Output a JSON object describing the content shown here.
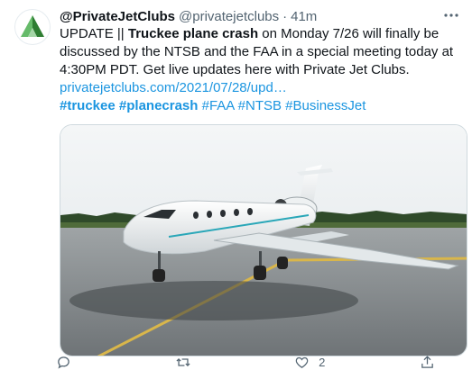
{
  "tweet": {
    "display_name": "@PrivateJetClubs",
    "handle": "@privatejetclubs",
    "separator": "·",
    "time": "41m",
    "text": {
      "prefix": "UPDATE || ",
      "bold": "Truckee plane crash",
      "rest": " on Monday 7/26 will finally be discussed by the NTSB and the FAA in a special meeting today at 4:30PM PDT. Get live updates here with Private Jet Clubs."
    },
    "link": "privatejetclubs.com/2021/07/28/upd…",
    "hashtags": {
      "tag1": "#truckee",
      "tag2": "#planecrash",
      "tag3": "#FAA",
      "tag4": "#NTSB",
      "tag5": "#BusinessJet"
    }
  },
  "actions": {
    "reply_count": "",
    "retweet_count": "",
    "like_count": "2"
  },
  "icons": {
    "avatar": "private-jet-clubs-logo",
    "more": "more-horizontal-icon",
    "reply": "reply-icon",
    "retweet": "retweet-icon",
    "like": "heart-icon",
    "share": "share-icon"
  },
  "colors": {
    "link": "#1b95e0",
    "secondary_text": "#536471",
    "logo_green": "#2e7d32"
  }
}
